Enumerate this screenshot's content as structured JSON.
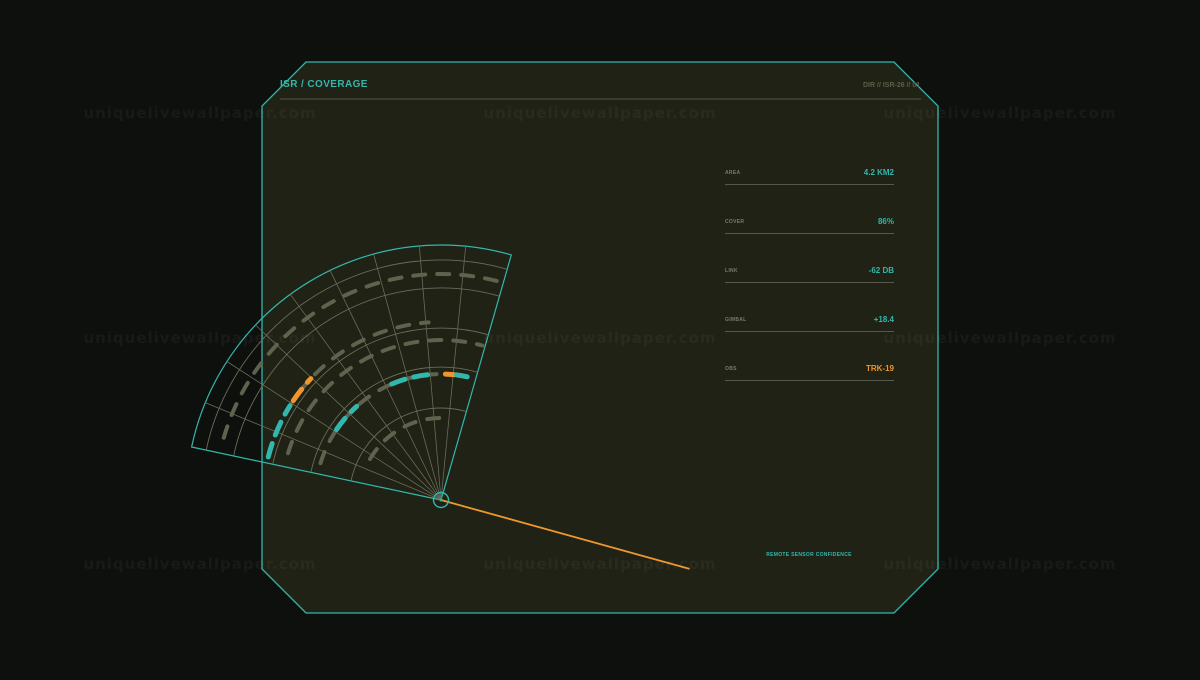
{
  "header": {
    "title": "ISR / COVERAGE",
    "meta": "DIR // ISR-26 // 01"
  },
  "stats": [
    {
      "label": "AREA",
      "value": "4.2 KM2",
      "status": "normal"
    },
    {
      "label": "COVER",
      "value": "86%",
      "status": "normal"
    },
    {
      "label": "LINK",
      "value": "-62 DB",
      "status": "normal"
    },
    {
      "label": "GIMBAL",
      "value": "+18.4",
      "status": "normal"
    },
    {
      "label": "OBS",
      "value": "TRK-19",
      "status": "warn"
    }
  ],
  "footer": {
    "caption": "REMOTE SENSOR CONFIDENCE"
  },
  "watermark": {
    "text": "uniquelivewallpaper.com"
  },
  "colors": {
    "accent": "#33b7ad",
    "warn": "#f0962e",
    "panel": "#1f2214",
    "background": "#0e100e",
    "muted": "#5f624c"
  },
  "radar": {
    "sector_start_deg": -78,
    "sector_end_deg": 16,
    "bearing_deg": 15.5,
    "rings": [
      {
        "from_deg": -60,
        "to_deg": 7,
        "level": "muted",
        "segments": []
      },
      {
        "from_deg": -73,
        "to_deg": 12,
        "level": "muted",
        "segments": [
          {
            "from_deg": -56,
            "to_deg": -42,
            "level": "accent"
          },
          {
            "from_deg": -23,
            "to_deg": -3,
            "level": "accent"
          },
          {
            "from_deg": 2,
            "to_deg": 6,
            "level": "warn"
          },
          {
            "from_deg": 7,
            "to_deg": 12,
            "level": "accent"
          }
        ]
      },
      {
        "from_deg": -73,
        "to_deg": 15,
        "level": "muted",
        "segments": []
      },
      {
        "from_deg": -76,
        "to_deg": -4,
        "level": "muted",
        "segments": [
          {
            "from_deg": -76,
            "to_deg": -58,
            "level": "accent"
          },
          {
            "from_deg": -56,
            "to_deg": -47,
            "level": "warn"
          }
        ]
      },
      {
        "from_deg": -74,
        "to_deg": 15,
        "level": "muted",
        "segments": []
      }
    ]
  }
}
